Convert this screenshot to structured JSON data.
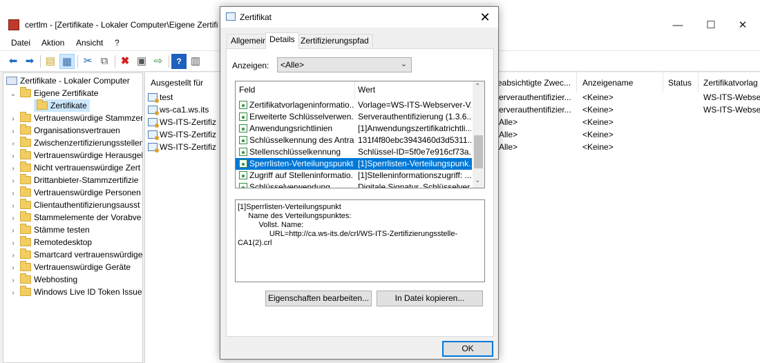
{
  "main": {
    "title": "certlm - [Zertifikate - Lokaler Computer\\Eigene Zertifi",
    "controls": {
      "minimize": "—",
      "maximize": "☐",
      "close": "✕"
    },
    "menu": [
      "Datei",
      "Aktion",
      "Ansicht",
      "?"
    ],
    "tree": [
      {
        "label": "Zertifikate - Lokaler Computer"
      },
      {
        "label": "Eigene Zertifikate"
      },
      {
        "label": "Zertifikate"
      },
      {
        "label": "Vertrauenswürdige Stammzer"
      },
      {
        "label": "Organisationsvertrauen"
      },
      {
        "label": "Zwischenzertifizierungsstellen"
      },
      {
        "label": "Vertrauenswürdige Herausgeb"
      },
      {
        "label": "Nicht vertrauenswürdige Zert"
      },
      {
        "label": "Drittanbieter-Stammzertifizie"
      },
      {
        "label": "Vertrauenswürdige Personen"
      },
      {
        "label": "Clientauthentifizierungsausst"
      },
      {
        "label": "Stammelemente der Vorabve"
      },
      {
        "label": "Stämme testen"
      },
      {
        "label": "Remotedesktop"
      },
      {
        "label": "Smartcard vertrauenswürdige"
      },
      {
        "label": "Vertrauenswürdige Geräte"
      },
      {
        "label": "Webhosting"
      },
      {
        "label": "Windows Live ID Token Issuer"
      }
    ],
    "list_headers": {
      "issued_to": "Ausgestellt für",
      "purposes": "eabsichtigte Zwec...",
      "friendly": "Anzeigename",
      "status": "Status",
      "template": "Zertifikatvorlag"
    },
    "rows": [
      {
        "issued_to": "test",
        "purposes": "erverauthentifizier...",
        "friendly": "<Keine>",
        "template": "WS-ITS-Webse"
      },
      {
        "issued_to": "ws-ca1.ws.its",
        "purposes": "erverauthentifizier...",
        "friendly": "<Keine>",
        "template": "WS-ITS-Webse"
      },
      {
        "issued_to": "WS-ITS-Zertifiz",
        "purposes": "Alle>",
        "friendly": "<Keine>",
        "template": ""
      },
      {
        "issued_to": "WS-ITS-Zertifiz",
        "purposes": "Alle>",
        "friendly": "<Keine>",
        "template": ""
      },
      {
        "issued_to": "WS-ITS-Zertifiz",
        "purposes": "Alle>",
        "friendly": "<Keine>",
        "template": ""
      }
    ]
  },
  "dialog": {
    "title": "Zertifikat",
    "close": "✕",
    "tabs": [
      "Allgemein",
      "Details",
      "Zertifizierungspfad"
    ],
    "show_label": "Anzeigen:",
    "show_value": "<Alle>",
    "field_header": "Feld",
    "value_header": "Wert",
    "fields": [
      {
        "field": "Zertifikatvorlageninformatio...",
        "value": "Vorlage=WS-ITS-Webserver-V..."
      },
      {
        "field": "Erweiterte Schlüsselverwen...",
        "value": "Serverauthentifizierung (1.3.6...."
      },
      {
        "field": "Anwendungsrichtlinien",
        "value": "[1]Anwendungszertifikatrichtli..."
      },
      {
        "field": "Schlüsselkennung des Antra...",
        "value": "131f4f80ebc3943460d3d5311..."
      },
      {
        "field": "Stellenschlüsselkennung",
        "value": "Schlüssel-ID=5f0e7e916cf73a..."
      },
      {
        "field": "Sperrlisten-Verteilungspunkte",
        "value": "[1]Sperrlisten-Verteilungspunk..."
      },
      {
        "field": "Zugriff auf Stelleninformatio...",
        "value": "[1]Stelleninformationszugriff: ..."
      },
      {
        "field": "Schlüsselverwendung",
        "value": "Digitale Signatur, Schlüsselver..."
      }
    ],
    "detail_lines": [
      "[1]Sperrlisten-Verteilungspunkt",
      "     Name des Verteilungspunktes:",
      "          Vollst. Name:",
      "               URL=http://ca.ws-its.de/crl/WS-ITS-Zertifizierungsstelle-",
      "CA1(2).crl"
    ],
    "edit_button": "Eigenschaften bearbeiten...",
    "copy_button": "In Datei kopieren...",
    "ok_button": "OK"
  }
}
